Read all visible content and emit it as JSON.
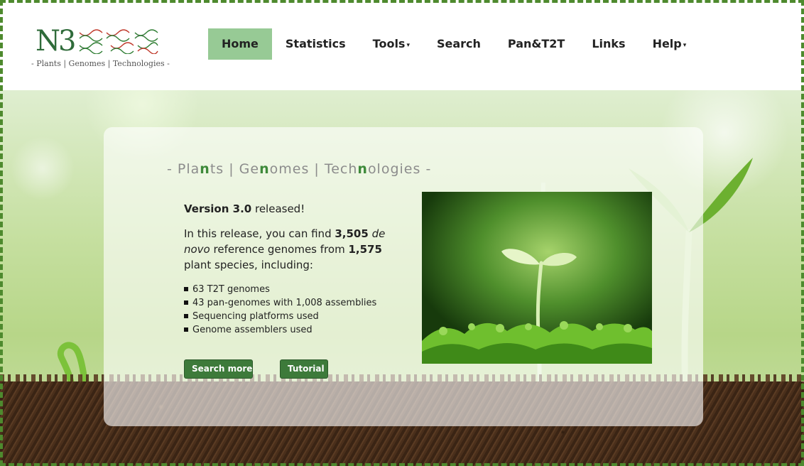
{
  "logo": {
    "mark": "N3",
    "subtitle": "- Plants | Genomes | Technologies -"
  },
  "nav": {
    "items": [
      {
        "label": "Home",
        "active": true,
        "dropdown": false
      },
      {
        "label": "Statistics",
        "active": false,
        "dropdown": false
      },
      {
        "label": "Tools",
        "active": false,
        "dropdown": true
      },
      {
        "label": "Search",
        "active": false,
        "dropdown": false
      },
      {
        "label": "Pan&T2T",
        "active": false,
        "dropdown": false
      },
      {
        "label": "Links",
        "active": false,
        "dropdown": false
      },
      {
        "label": "Help",
        "active": false,
        "dropdown": true
      }
    ],
    "caret": "▾"
  },
  "hero": {
    "tagline": {
      "dash_left": "- ",
      "plants_a": "Pla",
      "plants_b": "n",
      "plants_c": "ts",
      "sep1": " | ",
      "genomes_a": "Ge",
      "genomes_b": "n",
      "genomes_c": "omes",
      "sep2": " | ",
      "tech_a": "Tech",
      "tech_b": "n",
      "tech_c": "ologies",
      "dash_right": " -"
    },
    "version": {
      "bold": "Version 3.0",
      "rest": " released!"
    },
    "intro": {
      "part1": "In this release, you can find ",
      "count_genomes": "3,505",
      "part2": " ",
      "italic": "de novo",
      "part3": " reference genomes from ",
      "count_species": "1,575",
      "part4": " plant species, including:"
    },
    "list": [
      "63 T2T genomes",
      "43 pan-genomes with 1,008 assemblies",
      "Sequencing platforms used",
      "Genome assemblers used"
    ],
    "buttons": {
      "search_more": "Search more",
      "tutorial": "Tutorial"
    }
  },
  "colors": {
    "accent": "#3d7a3a",
    "nav_active": "#97ca95",
    "frame": "#4e8a2e"
  }
}
